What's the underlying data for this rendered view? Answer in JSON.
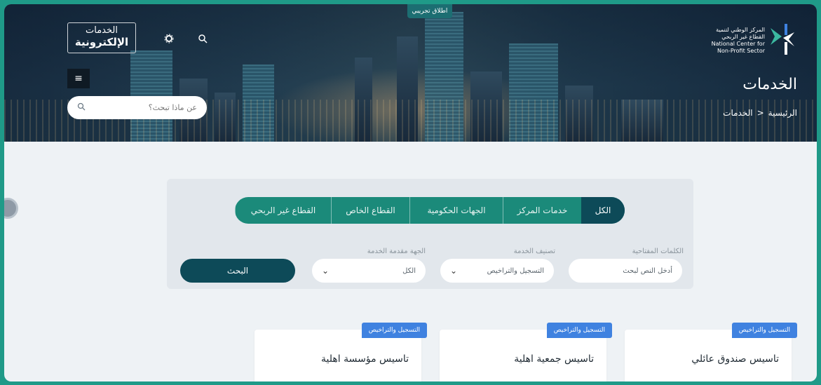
{
  "header": {
    "trial_tag": "اطلاق تجريبي",
    "eservices_line1": "الخدمات",
    "eservices_line2": "الإلكترونية",
    "search_placeholder": "عن ماذا تبحث؟",
    "logo_text": "المركز الوطني لتنمية القطاع غير الربحي National Center for Non-Profit Sector",
    "page_title": "الخدمات",
    "breadcrumb": {
      "home": "الرئيسية",
      "sep": ">",
      "current": "الخدمات"
    },
    "icons": {
      "settings": "gear-icon",
      "search": "search-icon",
      "menu": "hamburger-icon"
    }
  },
  "filters": {
    "tabs": [
      {
        "label": "الكل",
        "active": true
      },
      {
        "label": "خدمات المركز",
        "active": false
      },
      {
        "label": "الجهات الحكومية",
        "active": false
      },
      {
        "label": "القطاع الخاص",
        "active": false
      },
      {
        "label": "القطاع غير الربحي",
        "active": false
      }
    ],
    "keywords_label": "الكلمات المفتاحية",
    "keywords_placeholder": "أدخل النص لبحث",
    "category_label": "تصنيف الخدمة",
    "category_value": "التسجيل والتراخيص",
    "provider_label": "الجهة مقدمة الخدمة",
    "provider_value": "الكل",
    "search_button": "البحث"
  },
  "cards": [
    {
      "badge": "التسجيل والتراخيص",
      "title": "تاسيس صندوق عائلي"
    },
    {
      "badge": "التسجيل والتراخيص",
      "title": "تاسيس جمعية اهلية"
    },
    {
      "badge": "التسجيل والتراخيص",
      "title": "تاسيس مؤسسة اهلية"
    }
  ],
  "colors": {
    "accent": "#1b8a7a",
    "dark": "#0d4a58",
    "badge": "#3f82e0"
  }
}
